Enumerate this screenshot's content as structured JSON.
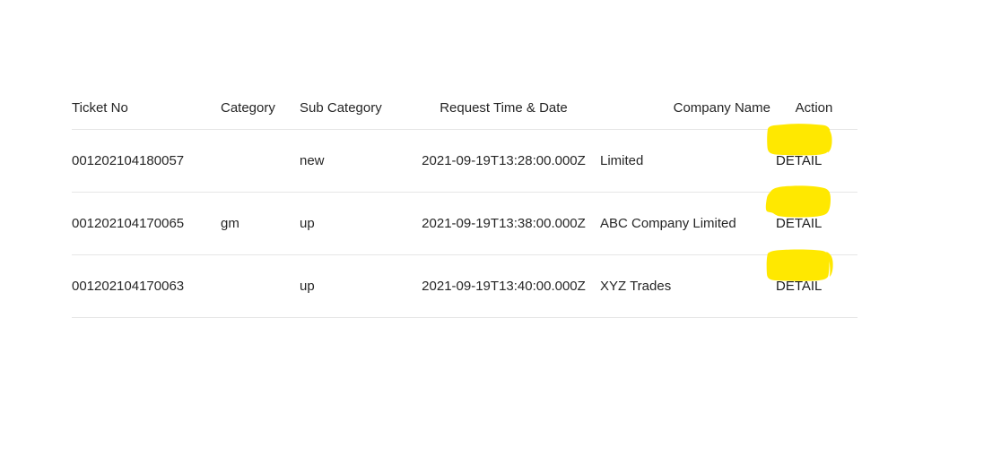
{
  "table": {
    "columns": [
      {
        "key": "ticket_no",
        "label": "Ticket No"
      },
      {
        "key": "category",
        "label": "Category"
      },
      {
        "key": "sub_category",
        "label": "Sub Category"
      },
      {
        "key": "request_time",
        "label": "Request Time & Date"
      },
      {
        "key": "company_name",
        "label": "Company Name"
      },
      {
        "key": "action",
        "label": "Action"
      }
    ],
    "rows": [
      {
        "ticket_no": "001202104180057",
        "category": "",
        "category_redacted": true,
        "sub_category": "new",
        "request_time": "2021-09-19T13:28:00.000Z",
        "company_name_faded": "",
        "company_name_tail": "Limited",
        "company_redacted": true,
        "action_label": "DETAIL"
      },
      {
        "ticket_no": "001202104170065",
        "category": "gm",
        "category_redacted": false,
        "sub_category": "up",
        "request_time": "2021-09-19T13:38:00.000Z",
        "company_name": "ABC Company Limited",
        "company_redacted": false,
        "action_label": "DETAIL"
      },
      {
        "ticket_no": "001202104170063",
        "category": "",
        "category_redacted": true,
        "sub_category": "up",
        "request_time": "2021-09-19T13:40:00.000Z",
        "company_name": "XYZ Trades",
        "company_redacted": false,
        "action_label": "DETAIL"
      }
    ]
  },
  "colors": {
    "highlight_yellow": "#FFE800",
    "text": "#262626",
    "row_divider": "#e6e6e6",
    "background": "#ffffff"
  }
}
